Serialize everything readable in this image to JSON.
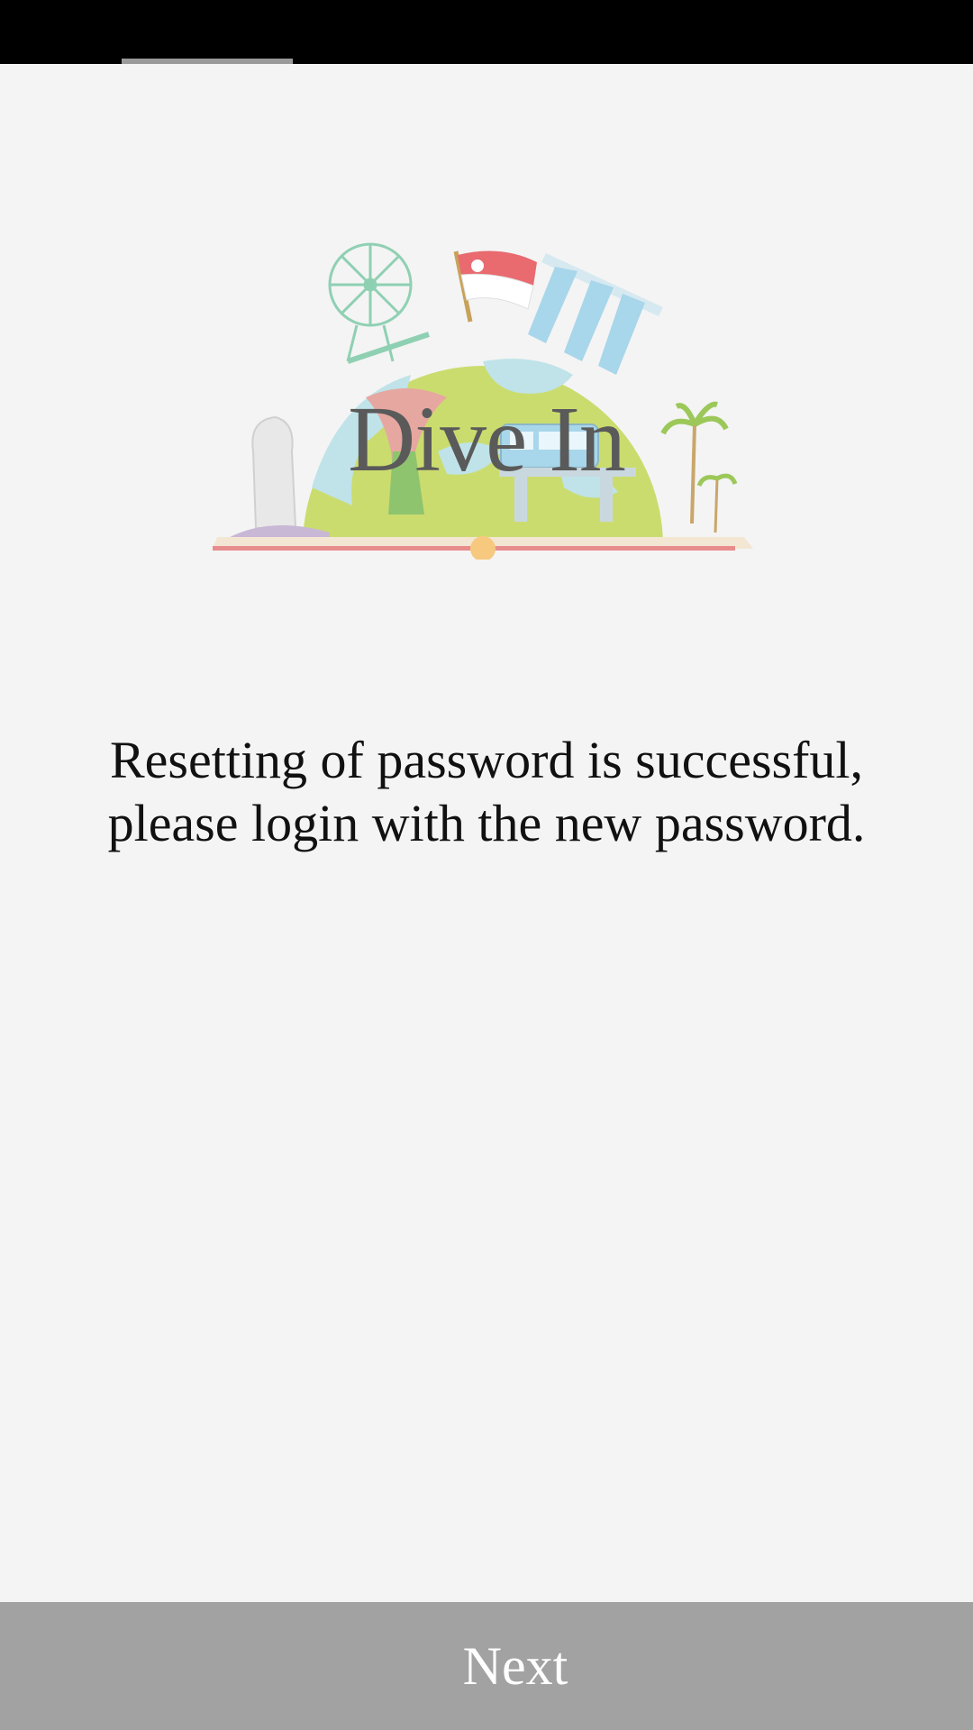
{
  "logo": {
    "title": "Dive In",
    "colors": {
      "globe_land": "#cbdc6f",
      "globe_sea": "#bfe3e8",
      "flag_red": "#e96a6f",
      "flag_white": "#ffffff",
      "base_line": "#e88d8d",
      "sand": "#f3e6d3"
    }
  },
  "message": {
    "line1": "Resetting of password is successful,",
    "line2": "please login with the new password."
  },
  "footer": {
    "next_label": "Next"
  },
  "colors": {
    "status_bar": "#000000",
    "background": "#f4f4f4",
    "button_bg": "#a2a2a2",
    "button_text": "#ffffff"
  }
}
